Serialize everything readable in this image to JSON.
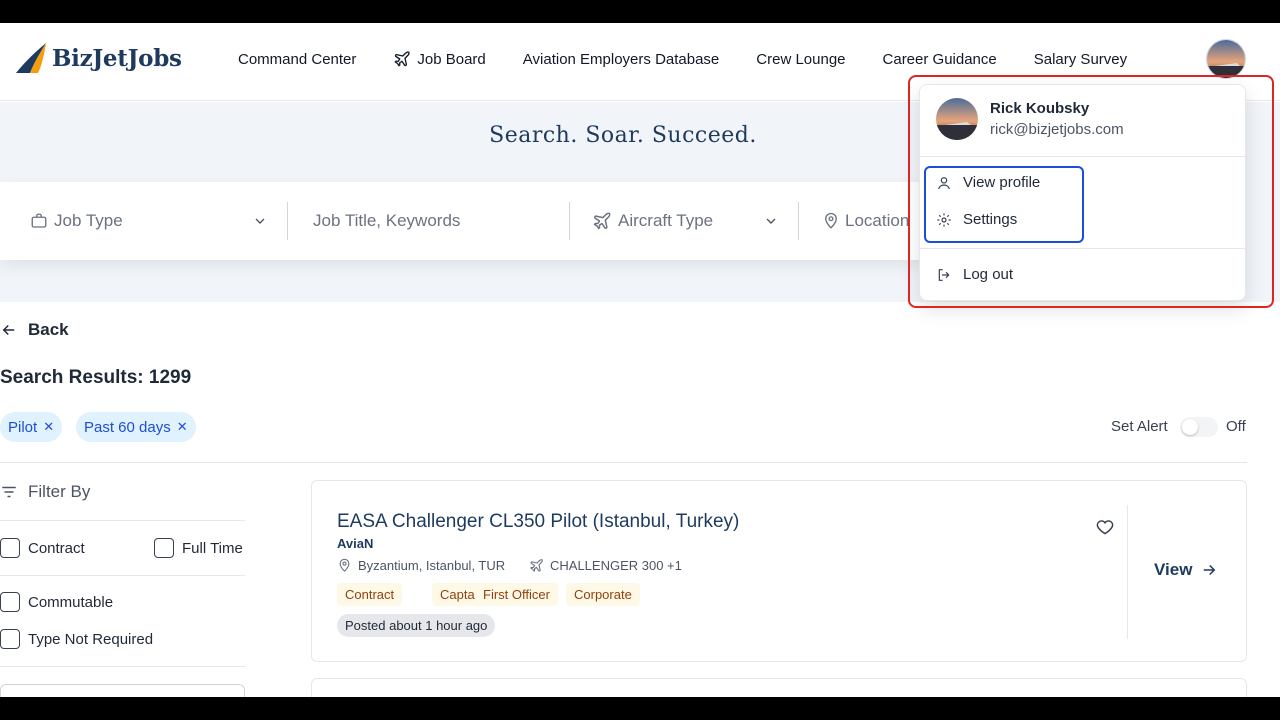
{
  "brand": {
    "name": "BizJetJobs"
  },
  "nav": {
    "items": [
      {
        "label": "Command Center"
      },
      {
        "label": "Job Board",
        "icon": "plane-icon"
      },
      {
        "label": "Aviation Employers Database"
      },
      {
        "label": "Crew Lounge"
      },
      {
        "label": "Career Guidance"
      },
      {
        "label": "Salary Survey"
      }
    ]
  },
  "hero": {
    "tagline": "Search. Soar. Succeed."
  },
  "search": {
    "job_type": "Job Type",
    "keywords": "Job Title, Keywords",
    "aircraft_type": "Aircraft Type",
    "location": "Location"
  },
  "results": {
    "back_label": "Back",
    "title": "Search Results: 1299",
    "chips": [
      {
        "label": "Pilot"
      },
      {
        "label": "Past 60 days"
      }
    ],
    "alert_label": "Set Alert",
    "alert_state": "Off",
    "alert_on": false
  },
  "filters": {
    "heading": "Filter By",
    "options": [
      {
        "label": "Contract",
        "checked": false
      },
      {
        "label": "Full Time",
        "checked": false
      },
      {
        "label": "Commutable",
        "checked": false
      },
      {
        "label": "Type Not Required",
        "checked": false
      }
    ]
  },
  "job": {
    "title": "EASA Challenger CL350 Pilot (Istanbul, Turkey)",
    "company": "AviaN",
    "location": "Byzantium, Istanbul, TUR",
    "aircraft": "CHALLENGER 300 +1",
    "tags": [
      "Contract",
      "Captain",
      "First Officer",
      "Corporate"
    ],
    "posted": "Posted about 1 hour ago",
    "view_label": "View"
  },
  "user_menu": {
    "name": "Rick Koubsky",
    "email": "rick@bizjetjobs.com",
    "items": [
      {
        "label": "View profile",
        "icon": "user-icon"
      },
      {
        "label": "Settings",
        "icon": "gear-icon"
      }
    ],
    "logout_label": "Log out"
  },
  "colors": {
    "brand_navy": "#1e3a5f",
    "chip_bg": "#e0f2fe",
    "tag_bg": "#fef9e7",
    "annotation_red": "#dc2626",
    "annotation_blue": "#1d4ed8"
  }
}
